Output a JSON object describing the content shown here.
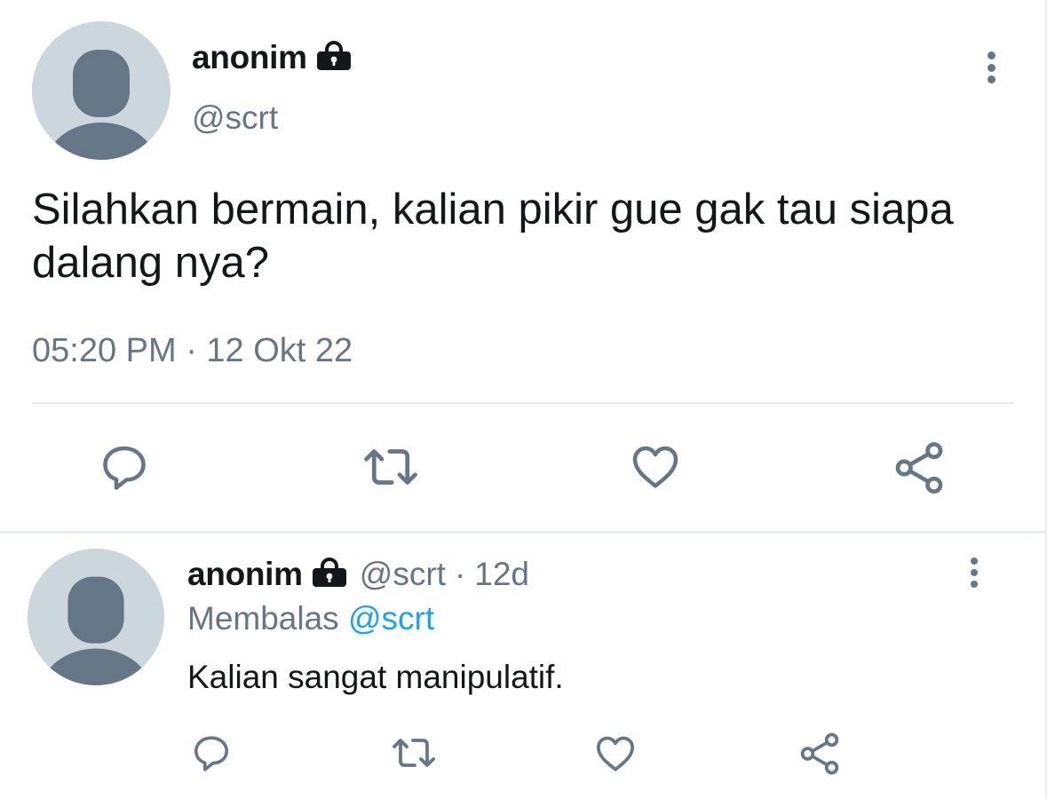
{
  "main_tweet": {
    "author_name": "anonim",
    "handle": "@scrt",
    "text": "Silahkan bermain, kalian pikir gue gak tau siapa dalang nya?",
    "timestamp": "05:20 PM · 12 Okt 22",
    "actions": [
      "reply-icon",
      "retweet-icon",
      "like-icon",
      "share-icon"
    ]
  },
  "reply_tweet": {
    "author_name": "anonim",
    "handle": "@scrt",
    "separator": "·",
    "time": "12d",
    "replying_prefix": "Membalas",
    "replying_to": "@scrt",
    "text": "Kalian sangat manipulatif.",
    "actions": [
      "reply-icon",
      "retweet-icon",
      "like-icon",
      "share-icon"
    ]
  },
  "colors": {
    "primary_text": "#14171a",
    "secondary_text": "#657786",
    "mention": "#1da1f2",
    "avatar_bg": "#ccd6dd",
    "avatar_figure": "#657786",
    "divider": "#e6ecf0"
  },
  "icons": {
    "protected": "lock-icon",
    "more": "more-vertical-icon"
  }
}
